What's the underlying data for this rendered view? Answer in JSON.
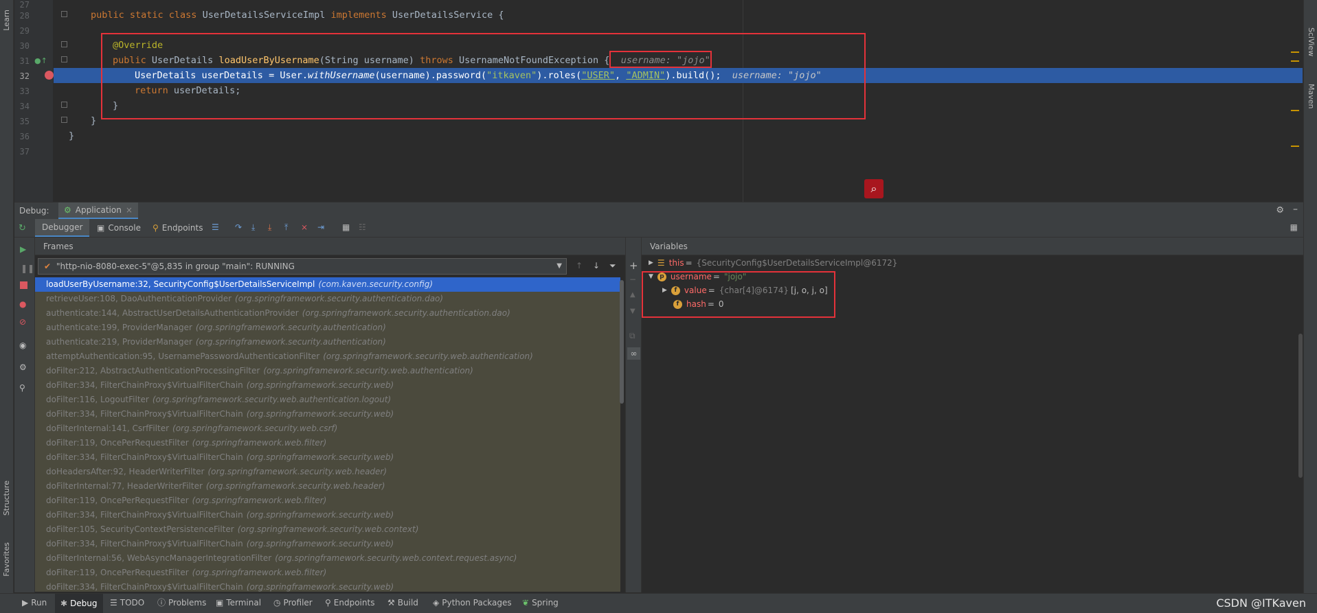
{
  "editor": {
    "line_numbers": [
      "27",
      "28",
      "29",
      "30",
      "31",
      "32",
      "33",
      "34",
      "35",
      "36",
      "37"
    ],
    "line28": {
      "kw": "public static class ",
      "name": "UserDetailsServiceImpl ",
      "kw2": "implements ",
      "iface": "UserDetailsService {"
    },
    "line30": "@Override",
    "line31": {
      "kw": "public ",
      "type": "UserDetails ",
      "fn": "loadUserByUsername",
      "args": "(String username) ",
      "kw2": "throws ",
      "exc": "UsernameNotFoundException {",
      "hint": "username: \"jojo\""
    },
    "line32": {
      "a": "UserDetails userDetails = User.",
      "b": "withUsername",
      "c": "(username).password(",
      "d": "\"itkaven\"",
      "e": ").roles(",
      "f": "\"USER\"",
      "g": ", ",
      "h": "\"ADMIN\"",
      "i": ").build();",
      "hint": "username: \"jojo\""
    },
    "line33": {
      "kw": "return ",
      "rest": "userDetails;"
    },
    "line34": "}",
    "line35": "}",
    "line36": "}"
  },
  "debug": {
    "label": "Debug:",
    "session": "Application",
    "tabs": {
      "debugger": "Debugger",
      "console": "Console",
      "endpoints": "Endpoints"
    },
    "frames_title": "Frames",
    "variables_title": "Variables",
    "thread": "\"http-nio-8080-exec-5\"@5,835 in group \"main\": RUNNING",
    "frames": [
      {
        "m": "loadUserByUsername:32, SecurityConfig$UserDetailsServiceImpl",
        "p": "(com.kaven.security.config)"
      },
      {
        "m": "retrieveUser:108, DaoAuthenticationProvider",
        "p": "(org.springframework.security.authentication.dao)"
      },
      {
        "m": "authenticate:144, AbstractUserDetailsAuthenticationProvider",
        "p": "(org.springframework.security.authentication.dao)"
      },
      {
        "m": "authenticate:199, ProviderManager",
        "p": "(org.springframework.security.authentication)"
      },
      {
        "m": "authenticate:219, ProviderManager",
        "p": "(org.springframework.security.authentication)"
      },
      {
        "m": "attemptAuthentication:95, UsernamePasswordAuthenticationFilter",
        "p": "(org.springframework.security.web.authentication)"
      },
      {
        "m": "doFilter:212, AbstractAuthenticationProcessingFilter",
        "p": "(org.springframework.security.web.authentication)"
      },
      {
        "m": "doFilter:334, FilterChainProxy$VirtualFilterChain",
        "p": "(org.springframework.security.web)"
      },
      {
        "m": "doFilter:116, LogoutFilter",
        "p": "(org.springframework.security.web.authentication.logout)"
      },
      {
        "m": "doFilter:334, FilterChainProxy$VirtualFilterChain",
        "p": "(org.springframework.security.web)"
      },
      {
        "m": "doFilterInternal:141, CsrfFilter",
        "p": "(org.springframework.security.web.csrf)"
      },
      {
        "m": "doFilter:119, OncePerRequestFilter",
        "p": "(org.springframework.web.filter)"
      },
      {
        "m": "doFilter:334, FilterChainProxy$VirtualFilterChain",
        "p": "(org.springframework.security.web)"
      },
      {
        "m": "doHeadersAfter:92, HeaderWriterFilter",
        "p": "(org.springframework.security.web.header)"
      },
      {
        "m": "doFilterInternal:77, HeaderWriterFilter",
        "p": "(org.springframework.security.web.header)"
      },
      {
        "m": "doFilter:119, OncePerRequestFilter",
        "p": "(org.springframework.web.filter)"
      },
      {
        "m": "doFilter:334, FilterChainProxy$VirtualFilterChain",
        "p": "(org.springframework.security.web)"
      },
      {
        "m": "doFilter:105, SecurityContextPersistenceFilter",
        "p": "(org.springframework.security.web.context)"
      },
      {
        "m": "doFilter:334, FilterChainProxy$VirtualFilterChain",
        "p": "(org.springframework.security.web)"
      },
      {
        "m": "doFilterInternal:56, WebAsyncManagerIntegrationFilter",
        "p": "(org.springframework.security.web.context.request.async)"
      },
      {
        "m": "doFilter:119, OncePerRequestFilter",
        "p": "(org.springframework.web.filter)"
      },
      {
        "m": "doFilter:334, FilterChainProxy$VirtualFilterChain",
        "p": "(org.springframework.security.web)"
      }
    ],
    "variables": {
      "this_name": "this",
      "this_val": "{SecurityConfig$UserDetailsServiceImpl@6172}",
      "username_name": "username",
      "username_val": "\"jojo\"",
      "value_name": "value",
      "value_ref": "{char[4]@6174}",
      "value_arr": "[j, o, j, o]",
      "hash_name": "hash",
      "hash_val": "0"
    }
  },
  "left_strip": {
    "learn": "Learn",
    "structure": "Structure",
    "favorites": "Favorites"
  },
  "right_strip": {
    "sciview": "SciView",
    "maven": "Maven"
  },
  "bottom_tabs": [
    "Run",
    "Debug",
    "TODO",
    "Problems",
    "Terminal",
    "Profiler",
    "Endpoints",
    "Build",
    "Python Packages",
    "Spring"
  ],
  "watermark": "CSDN @ITKaven",
  "colors": {
    "selection": "#2f65ca",
    "current_line": "#2d5ba3",
    "highlight_box": "#e5323a"
  }
}
